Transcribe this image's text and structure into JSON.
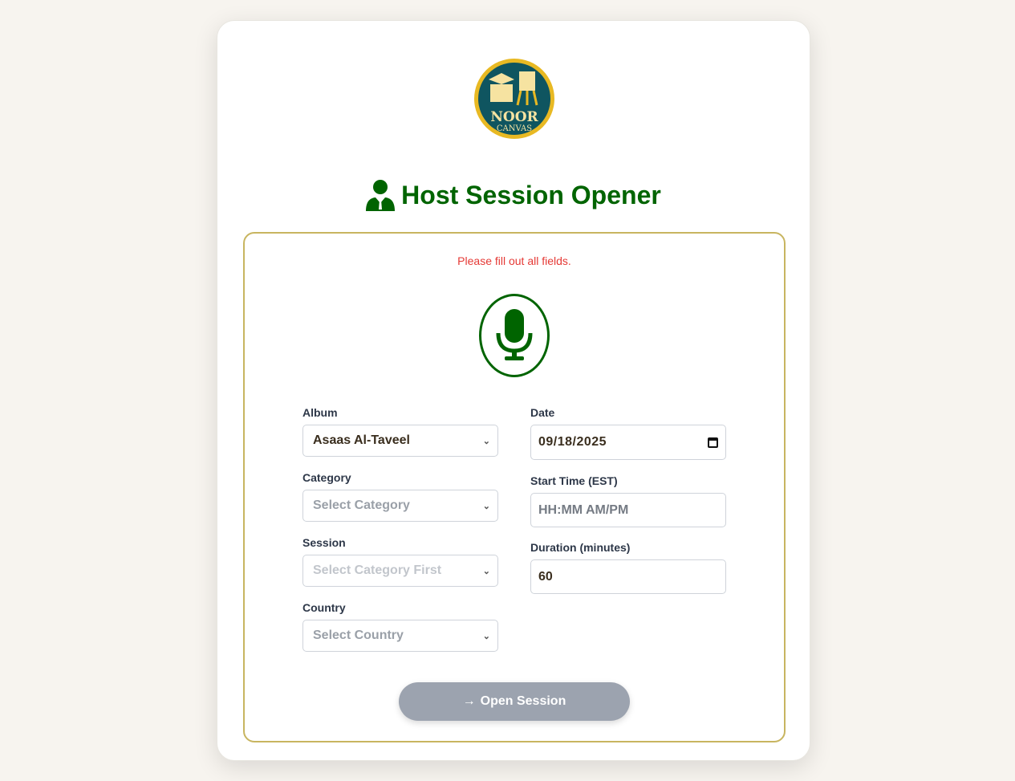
{
  "logo": {
    "line1": "NOOR",
    "line2": "CANVAS"
  },
  "header": {
    "title": "Host Session Opener",
    "icon": "user-tie-icon"
  },
  "form": {
    "error": "Please fill out all fields.",
    "album": {
      "label": "Album",
      "value": "Asaas Al-Taveel"
    },
    "category": {
      "label": "Category",
      "value": "Select Category"
    },
    "session": {
      "label": "Session",
      "value": "Select Category First"
    },
    "country": {
      "label": "Country",
      "value": "Select Country"
    },
    "date": {
      "label": "Date",
      "value": "09/18/2025"
    },
    "start_time": {
      "label": "Start Time (EST)",
      "placeholder": "HH:MM AM/PM"
    },
    "duration": {
      "label": "Duration (minutes)",
      "value": "60"
    },
    "submit": "Open Session"
  },
  "colors": {
    "primary": "#006400",
    "error": "#e53935",
    "border": "#c8b560"
  }
}
